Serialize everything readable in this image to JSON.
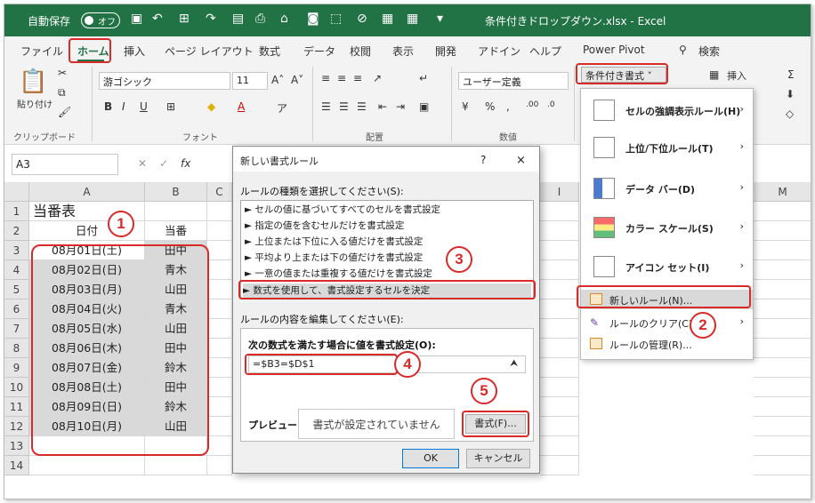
{
  "titlebar": {
    "autosave": "自動保存",
    "toggle": "オフ",
    "filename": "条件付きドロップダウン.xlsx  -  Excel"
  },
  "menu": [
    "ファイル",
    "ホーム",
    "挿入",
    "ページ レイアウト",
    "数式",
    "データ",
    "校閲",
    "表示",
    "開発",
    "アドイン",
    "ヘルプ",
    "Power Pivot",
    "検索"
  ],
  "ribbon": {
    "paste": "貼り付け",
    "font_name": "游ゴシック",
    "font_size": "11",
    "number_format": "ユーザー定義",
    "groups": {
      "clipboard": "クリップボード",
      "font": "フォント",
      "align": "配置",
      "number": "数値"
    },
    "cond_format": "条件付き書式",
    "insert": "挿入"
  },
  "formula_bar": {
    "namebox": "A3",
    "fx": "fx"
  },
  "columns": [
    "A",
    "B",
    "C",
    "I",
    "M"
  ],
  "rows": [
    "1",
    "2",
    "3",
    "4",
    "5",
    "6",
    "7",
    "8",
    "9",
    "10",
    "11",
    "12",
    "13",
    "14"
  ],
  "sheet": {
    "title": "当番表",
    "header_date": "日付",
    "header_duty": "当番",
    "data": [
      {
        "date": "08月01日(土)",
        "name": "田中"
      },
      {
        "date": "08月02日(日)",
        "name": "青木"
      },
      {
        "date": "08月03日(月)",
        "name": "山田"
      },
      {
        "date": "08月04日(火)",
        "name": "青木"
      },
      {
        "date": "08月05日(水)",
        "name": "山田"
      },
      {
        "date": "08月06日(木)",
        "name": "田中"
      },
      {
        "date": "08月07日(金)",
        "name": "鈴木"
      },
      {
        "date": "08月08日(土)",
        "name": "田中"
      },
      {
        "date": "08月09日(日)",
        "name": "鈴木"
      },
      {
        "date": "08月10日(月)",
        "name": "山田"
      }
    ]
  },
  "dialog": {
    "title": "新しい書式ルール",
    "help": "?",
    "close": "×",
    "select_label": "ルールの種類を選択してください(S):",
    "rules": [
      "► セルの値に基づいてすべてのセルを書式設定",
      "► 指定の値を含むセルだけを書式設定",
      "► 上位または下位に入る値だけを書式設定",
      "► 平均より上または下の値だけを書式設定",
      "► 一意の値または重複する値だけを書式設定",
      "► 数式を使用して、書式設定するセルを決定"
    ],
    "edit_label": "ルールの内容を編集してください(E):",
    "formula_label": "次の数式を満たす場合に値を書式設定(O):",
    "formula_value": "=$B3=$D$1",
    "preview_label": "プレビュー:",
    "preview_text": "書式が設定されていません",
    "format_button": "書式(F)...",
    "ok": "OK",
    "cancel": "キャンセル"
  },
  "cf_menu": {
    "items": [
      {
        "label": "セルの強調表示ルール(H)",
        "arrow": "›"
      },
      {
        "label": "上位/下位ルール(T)",
        "arrow": "›"
      },
      {
        "label": "データ バー(D)",
        "arrow": "›"
      },
      {
        "label": "カラー スケール(S)",
        "arrow": "›"
      },
      {
        "label": "アイコン セット(I)",
        "arrow": "›"
      }
    ],
    "new_rule": "新しいルール(N)...",
    "clear_rule": "ルールのクリア(C)",
    "manage_rule": "ルールの管理(R)...",
    "arrow": "›"
  },
  "badges": [
    "1",
    "2",
    "3",
    "4",
    "5"
  ],
  "colors": {
    "excel_green": "#217346",
    "annotation_red": "#d92a2a",
    "shaded": "#d9d9d9"
  }
}
